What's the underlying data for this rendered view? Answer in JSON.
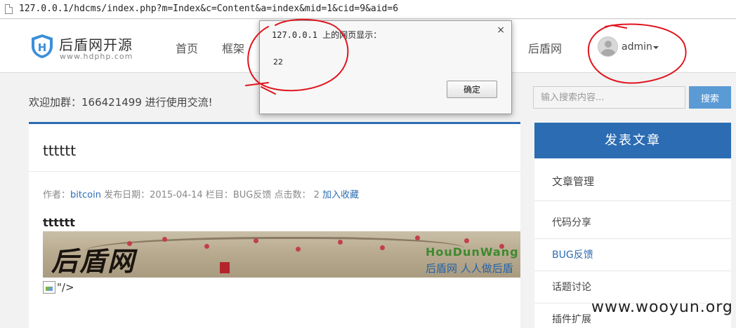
{
  "browser": {
    "url": "127.0.0.1/hdcms/index.php?m=Index&c=Content&a=index&mid=1&cid=9&aid=6"
  },
  "header": {
    "logo_title": "后盾网开源",
    "logo_sub": "www.hdphp.com",
    "nav": [
      "首页",
      "框架",
      "后盾网"
    ],
    "user_name": "admin"
  },
  "welcome": "欢迎加群：166421499 进行使用交流!",
  "search": {
    "placeholder": "输入搜索内容...",
    "button": "搜索"
  },
  "article": {
    "title": "tttttt",
    "meta": {
      "author_label": "作者：",
      "author": "bitcoin",
      "date_label": "发布日期：",
      "date": "2015-04-14",
      "column_label": "栏目：",
      "column": "BUG反馈",
      "clicks_label": "点击数：",
      "clicks": "2",
      "favorite": "加入收藏"
    },
    "content_heading": "tttttt",
    "banner": {
      "calligraphy": "后盾网",
      "brand": "HouDunWang",
      "slogan": "后盾网 人人做后盾"
    },
    "broken_tail": "\"/>"
  },
  "sidebar": {
    "post_button": "发表文章",
    "items": [
      {
        "label": "文章管理",
        "active": false
      },
      {
        "label": "代码分享",
        "active": false
      },
      {
        "label": "BUG反馈",
        "active": true
      },
      {
        "label": "话题讨论",
        "active": false
      },
      {
        "label": "插件扩展",
        "active": false
      }
    ]
  },
  "dialog": {
    "heading": "127.0.0.1 上的网页显示：",
    "message": "22",
    "ok": "确定",
    "close": "×"
  },
  "watermark": "www.wooyun.org",
  "colors": {
    "primary": "#2b6cb3",
    "search_button": "#5b9bd5",
    "annotation": "#e0141e"
  }
}
